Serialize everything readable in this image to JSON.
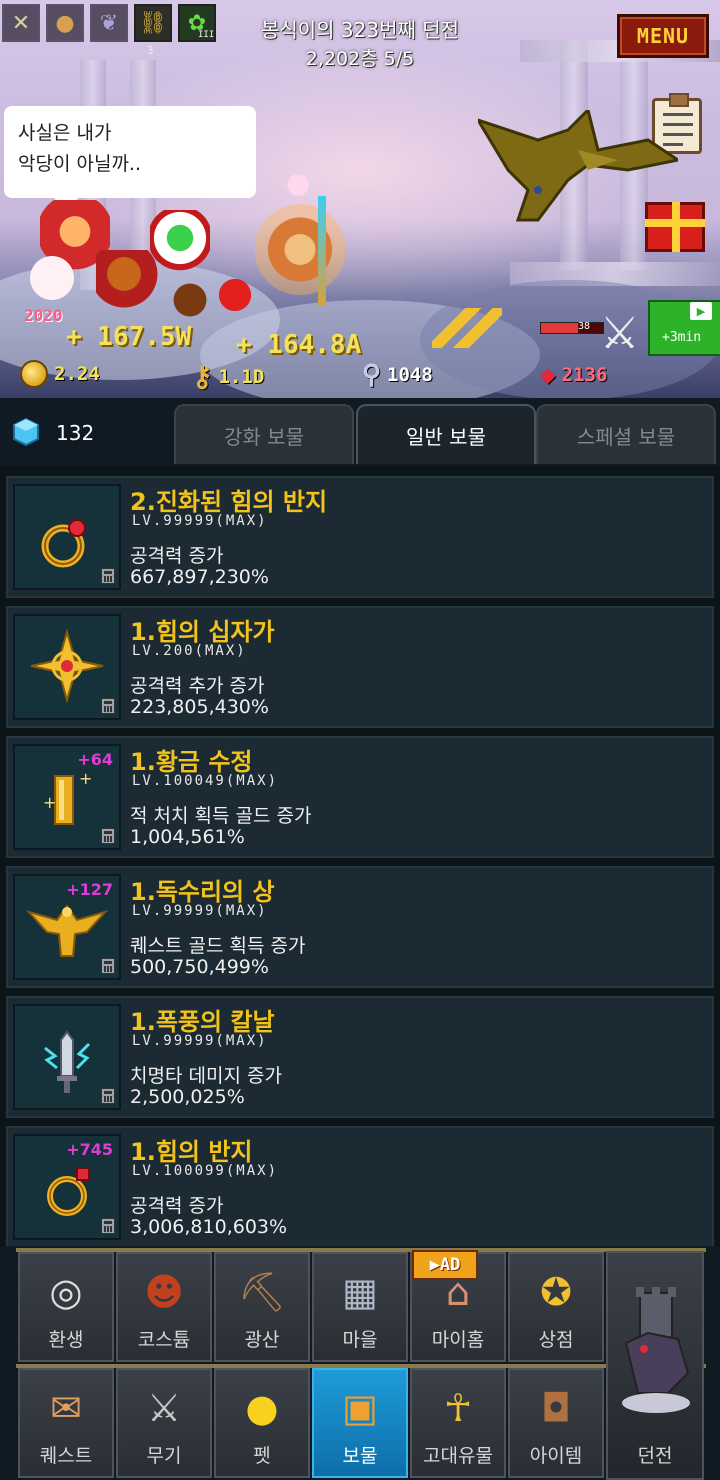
{
  "hud": {
    "status_slots": [
      {
        "icon": "crossed-swords-icon",
        "glyph": "✕"
      },
      {
        "icon": "cookie-icon",
        "glyph": "●"
      },
      {
        "icon": "wing-icon",
        "glyph": "❦"
      },
      {
        "icon": "chain-icon",
        "glyph": "⛓",
        "sub": "3"
      },
      {
        "icon": "sprout-icon",
        "glyph": "✿",
        "sub": "III"
      }
    ],
    "dungeon_title": "봉식이의 323번째 던전",
    "floor_info": "2,202층 5/5",
    "menu_label": "MENU",
    "speech_line1": "사실은 내가",
    "speech_line2": "악당이 아닐까..",
    "tag_2020": "2020",
    "dps_left": "+ 167.5W",
    "dps_right": "+ 164.8A",
    "boss_hp_text": "38",
    "boss_hp_fraction": 0.6,
    "boost_label": "+3min",
    "resources": {
      "gold": "2.24",
      "keys": "1.1D",
      "wand": "1048",
      "ruby": "2136"
    }
  },
  "gem_count": "132",
  "tabs": [
    {
      "label": "강화 보물",
      "active": false
    },
    {
      "label": "일반 보물",
      "active": true
    },
    {
      "label": "스페셜 보물",
      "active": false
    }
  ],
  "treasures": [
    {
      "name": "2.진화된 힘의 반지",
      "level": "LV.99999(MAX)",
      "effect": "공격력 증가",
      "value": "667,897,230%",
      "bonus": "",
      "icon": "evolved-ring-icon"
    },
    {
      "name": "1.힘의 십자가",
      "level": "LV.200(MAX)",
      "effect": "공격력 추가 증가",
      "value": "223,805,430%",
      "bonus": "",
      "icon": "cross-icon"
    },
    {
      "name": "1.황금 수정",
      "level": "LV.100049(MAX)",
      "effect": "적 처치 획득 골드 증가",
      "value": "1,004,561%",
      "bonus": "+64",
      "icon": "gold-crystal-icon"
    },
    {
      "name": "1.독수리의 상",
      "level": "LV.99999(MAX)",
      "effect": "퀘스트 골드 획득 증가",
      "value": "500,750,499%",
      "bonus": "+127",
      "icon": "eagle-statue-icon"
    },
    {
      "name": "1.폭풍의 칼날",
      "level": "LV.99999(MAX)",
      "effect": "치명타 데미지 증가",
      "value": "2,500,025%",
      "bonus": "",
      "icon": "storm-blade-icon"
    },
    {
      "name": "1.힘의 반지",
      "level": "LV.100099(MAX)",
      "effect": "공격력 증가",
      "value": "3,006,810,603%",
      "bonus": "+745",
      "icon": "ring-icon"
    }
  ],
  "nav_top": [
    {
      "label": "환생",
      "icon": "rebirth-icon",
      "glyph": "◎"
    },
    {
      "label": "코스튬",
      "icon": "mask-icon",
      "glyph": "☻"
    },
    {
      "label": "광산",
      "icon": "mine-cart-icon",
      "glyph": "⛏"
    },
    {
      "label": "마을",
      "icon": "village-icon",
      "glyph": "▦"
    },
    {
      "label": "마이홈",
      "icon": "home-icon",
      "glyph": "⌂"
    },
    {
      "label": "상점",
      "icon": "shop-icon",
      "glyph": "✪"
    }
  ],
  "nav_bottom": [
    {
      "label": "퀘스트",
      "icon": "scroll-icon",
      "glyph": "✉"
    },
    {
      "label": "무기",
      "icon": "sword-icon",
      "glyph": "⚔"
    },
    {
      "label": "펫",
      "icon": "chick-icon",
      "glyph": "●"
    },
    {
      "label": "보물",
      "icon": "treasure-chest-icon",
      "glyph": "▣",
      "active": true
    },
    {
      "label": "고대유물",
      "icon": "ankh-icon",
      "glyph": "☥"
    },
    {
      "label": "아이템",
      "icon": "bag-icon",
      "glyph": "◘"
    }
  ],
  "dungeon_nav_label": "던전",
  "ad_badge": "▶AD",
  "colors": {
    "name_gold": "#f2c31c",
    "bonus_magenta": "#e03bd6",
    "active_tab_blue": "#1f9bd8"
  }
}
